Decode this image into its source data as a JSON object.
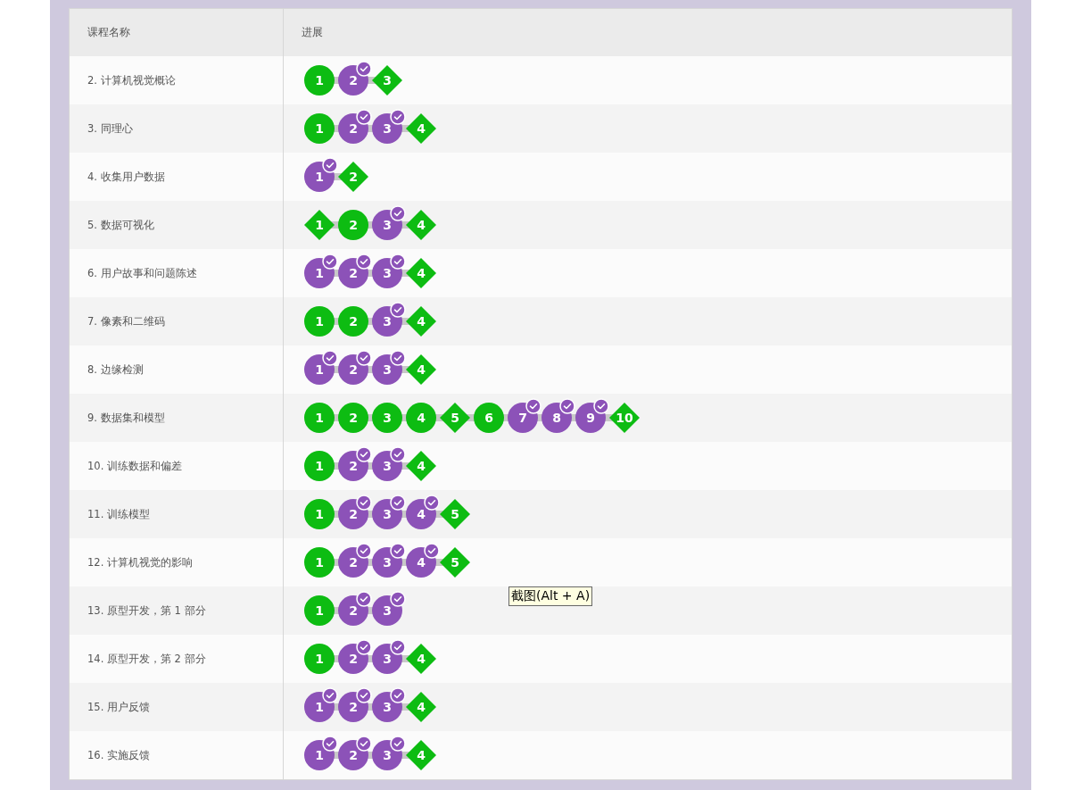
{
  "columns": [
    "课程名称",
    "进展"
  ],
  "rows": [
    {
      "name": "2. 计算机视觉概论",
      "steps": [
        {
          "label": "1",
          "kind": "circle",
          "done": false
        },
        {
          "label": "2",
          "kind": "circle",
          "done": true
        },
        {
          "label": "3",
          "kind": "diamond"
        }
      ]
    },
    {
      "name": "3. 同理心",
      "steps": [
        {
          "label": "1",
          "kind": "circle",
          "done": false
        },
        {
          "label": "2",
          "kind": "circle",
          "done": true
        },
        {
          "label": "3",
          "kind": "circle",
          "done": true
        },
        {
          "label": "4",
          "kind": "diamond"
        }
      ]
    },
    {
      "name": "4. 收集用户数据",
      "steps": [
        {
          "label": "1",
          "kind": "circle",
          "done": true
        },
        {
          "label": "2",
          "kind": "diamond"
        }
      ]
    },
    {
      "name": "5. 数据可视化",
      "steps": [
        {
          "label": "1",
          "kind": "diamond"
        },
        {
          "label": "2",
          "kind": "circle",
          "done": false
        },
        {
          "label": "3",
          "kind": "circle",
          "done": true
        },
        {
          "label": "4",
          "kind": "diamond"
        }
      ]
    },
    {
      "name": "6. 用户故事和问题陈述",
      "steps": [
        {
          "label": "1",
          "kind": "circle",
          "done": true
        },
        {
          "label": "2",
          "kind": "circle",
          "done": true
        },
        {
          "label": "3",
          "kind": "circle",
          "done": true
        },
        {
          "label": "4",
          "kind": "diamond"
        }
      ]
    },
    {
      "name": "7. 像素和二维码",
      "steps": [
        {
          "label": "1",
          "kind": "circle",
          "done": false
        },
        {
          "label": "2",
          "kind": "circle",
          "done": false
        },
        {
          "label": "3",
          "kind": "circle",
          "done": true
        },
        {
          "label": "4",
          "kind": "diamond"
        }
      ]
    },
    {
      "name": "8. 边缘检测",
      "steps": [
        {
          "label": "1",
          "kind": "circle",
          "done": true
        },
        {
          "label": "2",
          "kind": "circle",
          "done": true
        },
        {
          "label": "3",
          "kind": "circle",
          "done": true
        },
        {
          "label": "4",
          "kind": "diamond"
        }
      ]
    },
    {
      "name": "9. 数据集和模型",
      "steps": [
        {
          "label": "1",
          "kind": "circle",
          "done": false
        },
        {
          "label": "2",
          "kind": "circle",
          "done": false
        },
        {
          "label": "3",
          "kind": "circle",
          "done": false
        },
        {
          "label": "4",
          "kind": "circle",
          "done": false
        },
        {
          "label": "5",
          "kind": "diamond"
        },
        {
          "label": "6",
          "kind": "circle",
          "done": false
        },
        {
          "label": "7",
          "kind": "circle",
          "done": true
        },
        {
          "label": "8",
          "kind": "circle",
          "done": true
        },
        {
          "label": "9",
          "kind": "circle",
          "done": true
        },
        {
          "label": "10",
          "kind": "diamond"
        }
      ]
    },
    {
      "name": "10. 训练数据和偏差",
      "steps": [
        {
          "label": "1",
          "kind": "circle",
          "done": false
        },
        {
          "label": "2",
          "kind": "circle",
          "done": true
        },
        {
          "label": "3",
          "kind": "circle",
          "done": true
        },
        {
          "label": "4",
          "kind": "diamond"
        }
      ]
    },
    {
      "name": "11. 训练模型",
      "steps": [
        {
          "label": "1",
          "kind": "circle",
          "done": false
        },
        {
          "label": "2",
          "kind": "circle",
          "done": true
        },
        {
          "label": "3",
          "kind": "circle",
          "done": true
        },
        {
          "label": "4",
          "kind": "circle",
          "done": true
        },
        {
          "label": "5",
          "kind": "diamond"
        }
      ]
    },
    {
      "name": "12. 计算机视觉的影响",
      "steps": [
        {
          "label": "1",
          "kind": "circle",
          "done": false
        },
        {
          "label": "2",
          "kind": "circle",
          "done": true
        },
        {
          "label": "3",
          "kind": "circle",
          "done": true
        },
        {
          "label": "4",
          "kind": "circle",
          "done": true
        },
        {
          "label": "5",
          "kind": "diamond"
        }
      ]
    },
    {
      "name": "13. 原型开发，第 1 部分",
      "steps": [
        {
          "label": "1",
          "kind": "circle",
          "done": false
        },
        {
          "label": "2",
          "kind": "circle",
          "done": true
        },
        {
          "label": "3",
          "kind": "circle",
          "done": true
        }
      ]
    },
    {
      "name": "14. 原型开发，第 2 部分",
      "steps": [
        {
          "label": "1",
          "kind": "circle",
          "done": false
        },
        {
          "label": "2",
          "kind": "circle",
          "done": true
        },
        {
          "label": "3",
          "kind": "circle",
          "done": true
        },
        {
          "label": "4",
          "kind": "diamond"
        }
      ]
    },
    {
      "name": "15. 用户反馈",
      "steps": [
        {
          "label": "1",
          "kind": "circle",
          "done": true
        },
        {
          "label": "2",
          "kind": "circle",
          "done": true
        },
        {
          "label": "3",
          "kind": "circle",
          "done": true
        },
        {
          "label": "4",
          "kind": "diamond"
        }
      ]
    },
    {
      "name": "16. 实施反馈",
      "steps": [
        {
          "label": "1",
          "kind": "circle",
          "done": true
        },
        {
          "label": "2",
          "kind": "circle",
          "done": true
        },
        {
          "label": "3",
          "kind": "circle",
          "done": true
        },
        {
          "label": "4",
          "kind": "diamond"
        }
      ]
    }
  ],
  "tooltip": "截图(Alt + A)"
}
